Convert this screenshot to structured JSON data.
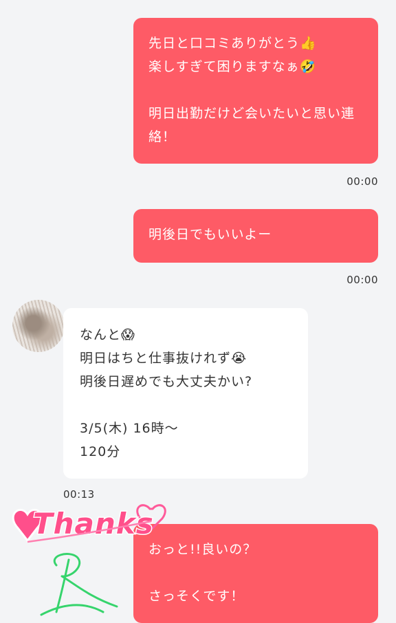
{
  "messages": [
    {
      "from": "me",
      "lines": [
        "先日と口コミありがとう👍",
        "楽しすぎて困りますなぁ🤣",
        "",
        "明日出勤だけど会いたいと思い連",
        "絡！"
      ],
      "time": "00:00"
    },
    {
      "from": "me",
      "lines": [
        "明後日でもいいよー"
      ],
      "time": "00:00"
    },
    {
      "from": "other",
      "lines": [
        "なんと😱",
        "明日はちと仕事抜けれず😭",
        "明後日遅めでも大丈夫かい?",
        "",
        "3/5(木) 16時〜",
        "120分"
      ],
      "time": "00:13"
    },
    {
      "from": "me",
      "lines": [
        "おっと!!良いの？",
        "",
        "さっそくです！"
      ]
    }
  ],
  "sticker": {
    "text": "Thanks",
    "signature": "R"
  },
  "colors": {
    "sent_bubble": "#fe5b66",
    "received_bubble": "#ffffff",
    "background": "#f3f4f6"
  }
}
